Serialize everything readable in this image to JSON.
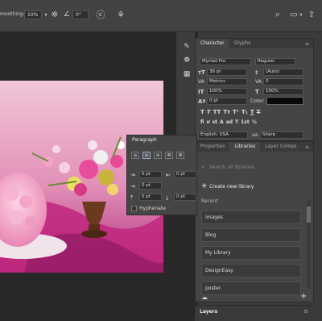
{
  "optbar": {
    "smoothing_label": "moothing:",
    "smoothing_value": "10%",
    "angle_value": "0°"
  },
  "character": {
    "tabs": [
      "Character",
      "Glyphs"
    ],
    "font_family": "Myriad Pro",
    "font_style": "Regular",
    "font_size": "36 pt",
    "leading": "(Auto)",
    "kerning": "Metrics",
    "tracking": "0",
    "vscale": "100%",
    "hscale": "100%",
    "baseline": "0 pt",
    "color_label": "Color:",
    "language": "English: USA",
    "aa_icon": "aa",
    "antialias": "Sharp",
    "type_buttons": [
      "T",
      "T",
      "TT",
      "Tт",
      "T¹",
      "T₁",
      "T",
      "T"
    ],
    "opentype_buttons": [
      "fi",
      "ơ",
      "st",
      "A",
      "ad",
      "T",
      "1st",
      "½"
    ]
  },
  "paragraph": {
    "title": "Paragraph",
    "indent_left": "0 pt",
    "indent_right": "0 pt",
    "indent_first": "0 pt",
    "space_before": "0 pt",
    "space_after": "0 pt",
    "hyphenate": "Hyphenate"
  },
  "libraries": {
    "tabs": [
      "Properties",
      "Libraries",
      "Layer Comps"
    ],
    "search_placeholder": "Search all libraries",
    "create_label": "Create new library",
    "recent_label": "Recent",
    "items": [
      "Images",
      "Blog",
      "My Library",
      "DesignEasy",
      "poster"
    ]
  },
  "layers": {
    "title": "Layers"
  },
  "colors": {
    "accent": "#4a90e2",
    "panel": "#454545"
  }
}
